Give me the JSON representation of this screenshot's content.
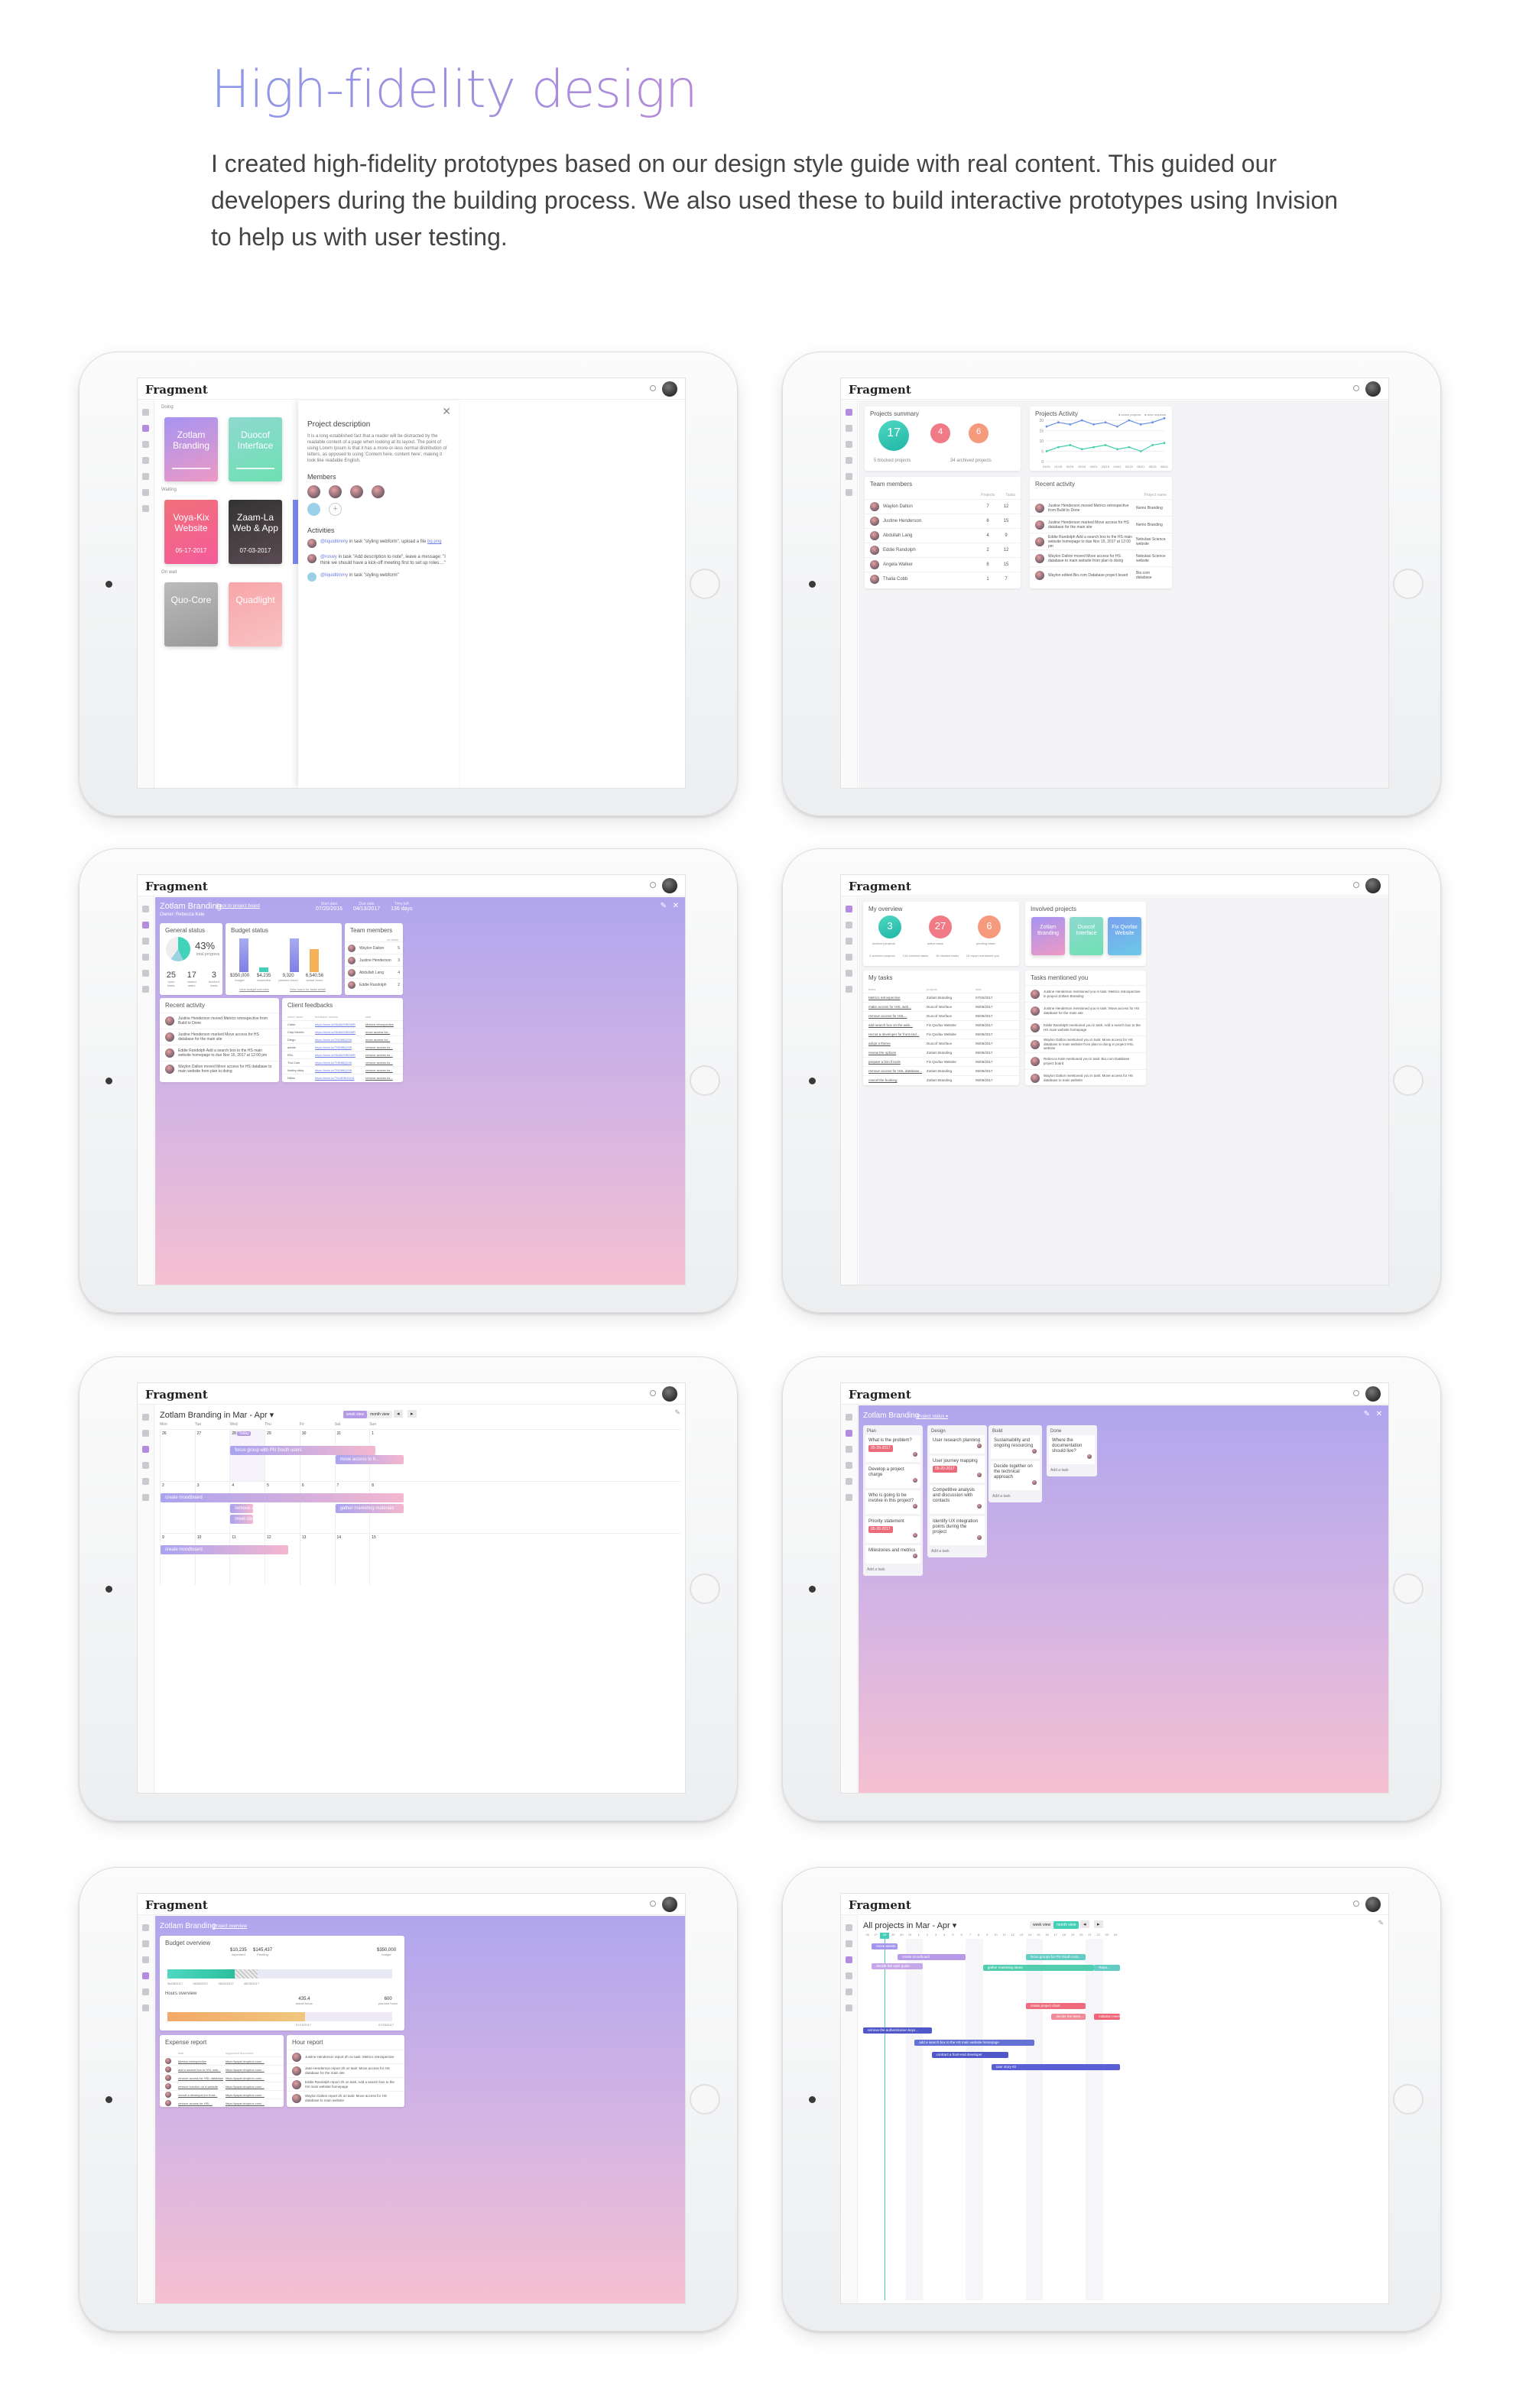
{
  "hero": {
    "title": "High-fidelity design",
    "body": "I created high-fidelity prototypes based on our design style guide with real content. This guided our developers during the building process. We also used these to build interactive prototypes using Invision to help us with user testing."
  },
  "app": {
    "logo": "Fragment"
  },
  "s1": {
    "sections": [
      "Doing",
      "Waiting",
      "On wait"
    ],
    "tiles": [
      {
        "label": "Zotlam Branding",
        "date": ""
      },
      {
        "label": "Duocof Interface",
        "date": ""
      },
      {
        "label": "Voya-Kix Website",
        "date": "05-17-2017"
      },
      {
        "label": "Zaam-La Web & App",
        "date": "07-03-2017"
      },
      {
        "label": "Quo-Core",
        "date": ""
      },
      {
        "label": "Quadlight",
        "date": ""
      }
    ],
    "panel_title": "Project description",
    "panel_text": "It is a long established fact that a reader will be distracted by the readable content of a page when looking at its layout. The point of using Lorem Ipsum is that it has a more-or-less normal distribution of letters, as opposed to using 'Content here, content here', making it look like readable English.",
    "members_title": "Members",
    "activities_title": "Activities",
    "activities": [
      {
        "user": "@liquidtimmy",
        "text": "in task \"styling webform\", upload a file",
        "link": "bg.png"
      },
      {
        "user": "@roswy",
        "text": "in task \"Add description to note\", leave a message: \"I think we should have a kick-off meeting first to set up roles....\"",
        "link": ""
      },
      {
        "user": "@liquidtimmy",
        "text": "in task \"styling webform\"",
        "link": ""
      }
    ]
  },
  "s2": {
    "summary_title": "Projects summary",
    "summary_stats": [
      {
        "value": "17",
        "label": "active"
      },
      {
        "value": "4",
        "label": "pending"
      },
      {
        "value": "6",
        "label": "waiting"
      }
    ],
    "blocked": "5 blocked projects",
    "archived": "34 archived projects",
    "activity_title": "Projects Activity",
    "activity_legend": [
      "Active projects",
      "New requests"
    ],
    "chart_data": {
      "type": "line",
      "x": [
        "01/01",
        "01/15",
        "02/01",
        "02/15",
        "03/01",
        "03/15",
        "04/01",
        "04/15",
        "05/01",
        "05/15",
        "06/01"
      ],
      "series": [
        {
          "name": "Active projects",
          "values": [
            17,
            19,
            18,
            20,
            18,
            19,
            17,
            20,
            18,
            19,
            21
          ]
        },
        {
          "name": "New requests",
          "values": [
            5,
            7,
            8,
            6,
            7,
            8,
            6,
            7,
            5,
            8,
            9
          ]
        }
      ],
      "ylim": [
        0,
        20
      ],
      "yticks": [
        "0",
        "5",
        "10",
        "15",
        "20"
      ]
    },
    "team_title": "Team members",
    "team_cols": [
      "Projects",
      "Tasks"
    ],
    "team": [
      {
        "name": "Waylon Dalton",
        "projects": "7",
        "tasks": "12"
      },
      {
        "name": "Justine Henderson",
        "projects": "6",
        "tasks": "15"
      },
      {
        "name": "Abdullah Lang",
        "projects": "4",
        "tasks": "9"
      },
      {
        "name": "Eddie Randolph",
        "projects": "2",
        "tasks": "12"
      },
      {
        "name": "Angela Walker",
        "projects": "8",
        "tasks": "15"
      },
      {
        "name": "Thalia Cobb",
        "projects": "1",
        "tasks": "7"
      }
    ],
    "recent_title": "Recent activity",
    "recent_col": "Project name",
    "recent": [
      {
        "text": "Justine Henderson moved Metrics retrospective from Build to Done",
        "project": "Nemo Branding"
      },
      {
        "text": "Justine Henderson marked Move access for HS database for the main site",
        "project": "Nemo Branding"
      },
      {
        "text": "Eddie Randolph Add a search box to the HS main website homepage to due Nov 15, 2017 at 12:00 pm",
        "project": "Nebulasi Science website"
      },
      {
        "text": "Waylon Dalton moved Move access for HS database to main website from plan to doing",
        "project": "Nebulasi Science website"
      },
      {
        "text": "Waylon edited Bio.com Database project board",
        "project": "Bio.com database"
      }
    ]
  },
  "s3": {
    "title": "Zotlam Branding",
    "back": "Back to project board",
    "owner": "Owner: Rebecca Kale",
    "dates": [
      {
        "label": "Start date",
        "value": "07/20/2016"
      },
      {
        "label": "Due date",
        "value": "04/13/2017"
      },
      {
        "label": "Time left",
        "value": "136 days"
      }
    ],
    "general_title": "General status",
    "general_pct": "43%",
    "general_pct_label": "total progress",
    "general_stats": [
      {
        "v": "25",
        "l": "open tasks"
      },
      {
        "v": "17",
        "l": "closed tasks"
      },
      {
        "v": "3",
        "l": "blocked tasks"
      }
    ],
    "budget_title": "Budget status",
    "budget_vals": [
      {
        "v": "$350,000",
        "l": "budget"
      },
      {
        "v": "$4,235",
        "l": "expended"
      },
      {
        "v": "9,320",
        "l": "planned hours"
      },
      {
        "v": "6,540.56",
        "l": "actual hours"
      }
    ],
    "budget_links": [
      "View budget overview",
      "View hours for tasks detail"
    ],
    "team_title": "Team members",
    "team_col": "on tasks",
    "team": [
      {
        "n": "Waylon Dalton",
        "v": "5"
      },
      {
        "n": "Justine Henderson",
        "v": "3"
      },
      {
        "n": "Abdullah Lang",
        "v": "4"
      },
      {
        "n": "Eddie Randolph",
        "v": "2"
      }
    ],
    "recent_title": "Recent activity",
    "recent": [
      "Justine Henderson moved Metrics retrospective from Build to Done",
      "Justine Henderson marked Move access for HS database for the main site",
      "Eddie Randolph Add a search box to the HS main website homepage to due Nov 15, 2017 at 12:00 pm",
      "Waylon Dalton moved Move access for HS database to main website from plan to doing"
    ],
    "feedback_title": "Client feedbacks",
    "feedback_cols": [
      "client name",
      "feedback version",
      "task"
    ],
    "feedback": [
      {
        "c": "Claire",
        "f": "https://invis.io/9DA6HSBGMR",
        "t": "Metrics retrospective"
      },
      {
        "c": "Chip Morelo",
        "f": "https://invis.io/9DA6HSBGMR",
        "t": "move access for..."
      },
      {
        "c": "Diego",
        "f": "https://invis.io/THD88Q298",
        "t": "move access for..."
      },
      {
        "c": "admin",
        "f": "https://invis.io/THD88Q298",
        "t": "remove access for..."
      },
      {
        "c": "RSL",
        "f": "https://invis.io/9DA6HSBGMR",
        "t": "remove access for..."
      },
      {
        "c": "Thu Cole",
        "f": "https://invis.io/THD88Q298",
        "t": "remove access for..."
      },
      {
        "c": "Nobby nbby",
        "f": "https://invis.io/THD88Q298",
        "t": "remove access for..."
      },
      {
        "c": "Nikes",
        "f": "https://invis.io/THL8EBUUH4",
        "t": "remove access for..."
      }
    ]
  },
  "s4": {
    "overview_title": "My overview",
    "overview_stats": [
      {
        "v": "3",
        "l": "involved projects"
      },
      {
        "v": "27",
        "l": "active tasks"
      },
      {
        "v": "6",
        "l": "pending tasks"
      }
    ],
    "overview_sub": [
      "3 archived projects",
      "134 archived tasks",
      "15 blocked tasks",
      "15 report mentioned you"
    ],
    "involved_title": "Involved projects",
    "involved": [
      "Zotlam Branding",
      "Duocof Interface",
      "Fix Qvofax Website"
    ],
    "tasks_title": "My tasks",
    "tasks_cols": [
      "tasks",
      "projects",
      "date"
    ],
    "tasks": [
      {
        "t": "Metrics retrospective",
        "p": "Zotlam Branding",
        "d": "07/02/2017"
      },
      {
        "t": "make access for HSL web...",
        "p": "Duocof Interface",
        "d": "06/05/2017"
      },
      {
        "t": "remove access for HSL...",
        "p": "Duocof Interface",
        "d": "06/05/2017"
      },
      {
        "t": "add search box on the web...",
        "p": "Fix Qvofax Website",
        "d": "06/05/2017"
      },
      {
        "t": "recruit a developer for front end...",
        "p": "Fix Qvofax Website",
        "d": "06/05/2017"
      },
      {
        "t": "adopt a theme",
        "p": "Duocof Interface",
        "d": "06/05/2017"
      },
      {
        "t": "review the options",
        "p": "Zotlam Branding",
        "d": "06/05/2017"
      },
      {
        "t": "prepare a list of tools",
        "p": "Fix Qvofax Website",
        "d": "06/05/2017"
      },
      {
        "t": "remove access for HSL database...",
        "p": "Zotlam Branding",
        "d": "06/05/2017"
      },
      {
        "t": "cancel the booking",
        "p": "Zotlam Branding",
        "d": "06/05/2017"
      }
    ],
    "mentioned_title": "Tasks mentioned you",
    "mentioned": [
      "Justine Henderson mentioned you in task: Metrics retrospective in project Zotlam Branding",
      "Justine Henderson mentioned you in task: Move access for HS database for the main site",
      "Eddie Randolph mentioned you in task: Add a search box to the HS main website homepage",
      "Waylon Dalton mentioned you in task: Move access for HS database to main website from plan to doing in project HSL website",
      "Rebecca Kale mentioned you in task: Bio.com Database project board",
      "Waylon Dalton mentioned you in task: Move access for HS database to main website"
    ]
  },
  "s5": {
    "title": "Zotlam Branding in Mar - Apr",
    "views": [
      "week view",
      "month view"
    ],
    "days": [
      "Mon",
      "Tue",
      "Wed",
      "Thu",
      "Fri",
      "Sat",
      "Sun"
    ],
    "weeks": [
      [
        "26",
        "27",
        "28",
        "29",
        "30",
        "31",
        "1"
      ],
      [
        "2",
        "3",
        "4",
        "5",
        "6",
        "7",
        "8"
      ],
      [
        "9",
        "10",
        "11",
        "12",
        "13",
        "14",
        "15"
      ]
    ],
    "today": "Today",
    "events": [
      "focus group with PN South users",
      "move access to h...",
      "create moodboard",
      "remove access for...",
      "gather marketing materials",
      "meet client for ba...",
      "create moodboard"
    ]
  },
  "s6": {
    "title": "Zotlam Branding",
    "status": "Project status",
    "columns": [
      {
        "name": "Plan",
        "cards": [
          "What is the problem?",
          "Develop a project charge",
          "Who is going to be involve in this project?",
          "Priority statement",
          "Milestones and metrics"
        ],
        "add": "Add a task"
      },
      {
        "name": "Design",
        "cards": [
          "User research planning",
          "User journey mapping",
          "Competitive analysis and discussion with contacts",
          "Identify UX integration points during the project"
        ],
        "add": "Add a task"
      },
      {
        "name": "Build",
        "cards": [
          "Sustainability and ongoing resourcing",
          "Decide together on the technical approach"
        ],
        "add": "Add a task"
      },
      {
        "name": "Done",
        "cards": [
          "Where the documentation should live?"
        ],
        "add": "Add a task"
      }
    ],
    "tag": "05-20-2017"
  },
  "s7": {
    "title": "Zotlam Branding",
    "link": "Project overview",
    "budget_title": "Budget overview",
    "budget_vals": [
      {
        "v": "$10,235",
        "l": "expended"
      },
      {
        "v": "$145,437",
        "l": "Pending"
      },
      {
        "v": "$350,000",
        "l": "budget"
      }
    ],
    "budget_dates": [
      "06/05/2017",
      "06/05/2017",
      "06/05/2017",
      "06/05/2017"
    ],
    "hours_title": "Hours overview",
    "hours_vals": [
      {
        "v": "435.4",
        "l": "actual hours"
      },
      {
        "v": "600",
        "l": "planned hours"
      }
    ],
    "hours_dates": [
      "07/15/2017",
      "07/25/2017"
    ],
    "expense_title": "Expense report",
    "expense_cols": [
      "task",
      "supported document"
    ],
    "expense": [
      {
        "t": "Metrics retrospective",
        "d": "https://paper.dropbox.com/..."
      },
      {
        "t": "add a search box to HSL web...",
        "d": "https://paper.dropbox.com/..."
      },
      {
        "t": "remove access for HSL database",
        "d": "https://paper.dropbox.com/..."
      },
      {
        "t": "remove function on a website",
        "d": "https://paper.dropbox.com/..."
      },
      {
        "t": "recruit a developer for front...",
        "d": "https://paper.dropbox.com/..."
      },
      {
        "t": "remove access for HSL...",
        "d": "https://paper.dropbox.com/..."
      }
    ],
    "hour_title": "Hour report",
    "hour": [
      "Justine Henderson report 2h on task: Metrics retrospective",
      "Jane Henderson report 2h on task: Move access for HS database for the main site",
      "Eddie Randolph report 2h on task: Add a search box to the HS main website homepage",
      "Waylon Dalton report 2h on task: Move access for HS database to main website"
    ]
  },
  "s8": {
    "title": "All projects in Mar - Apr",
    "views": [
      "week view",
      "month view"
    ],
    "dates": [
      "26",
      "27",
      "28",
      "29",
      "30",
      "31",
      "1",
      "2",
      "3",
      "4",
      "5",
      "6",
      "7",
      "8",
      "9",
      "10",
      "11",
      "12",
      "13",
      "14",
      "15",
      "16",
      "17",
      "18",
      "19",
      "20",
      "21",
      "22",
      "23",
      "24"
    ],
    "bars": [
      "move assets",
      "create moodboard",
      "focus groups for PN South cust...",
      "decide the style guide",
      "gather marketing ideas",
      "Repo...",
      "create project chart",
      "decide the team...",
      "initiation meeting",
      "remove the authentication keys...",
      "add a search box to the HS main website homepage",
      "contract a front-end developer",
      "user story #2"
    ]
  }
}
